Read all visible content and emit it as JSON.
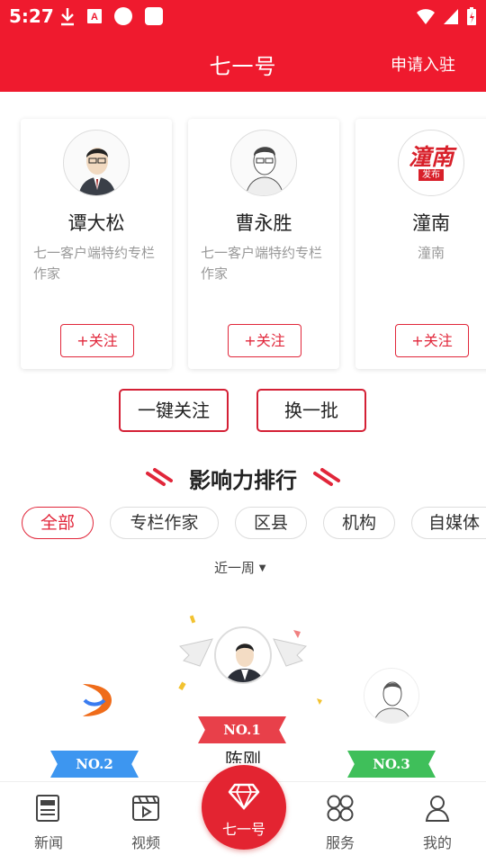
{
  "status": {
    "time": "5:27"
  },
  "header": {
    "title": "七一号",
    "apply": "申请入驻"
  },
  "cards": [
    {
      "name": "谭大松",
      "desc": "七一客户端特约专栏作家",
      "follow": "+关注"
    },
    {
      "name": "曹永胜",
      "desc": "七一客户端特约专栏作家",
      "follow": "+关注"
    },
    {
      "name": "潼南",
      "desc": "潼南",
      "follow": "+关注",
      "logo_text": "潼南",
      "logo_sub": "发布"
    }
  ],
  "actions": {
    "follow_all": "一键关注",
    "refresh": "换一批"
  },
  "ranking": {
    "title": "影响力排行",
    "filters": [
      "全部",
      "专栏作家",
      "区县",
      "机构",
      "自媒体"
    ],
    "active_filter": "全部",
    "period": "近一周",
    "podium": [
      {
        "rank": "NO.1",
        "name": "陈刚"
      },
      {
        "rank": "NO.2",
        "name": ""
      },
      {
        "rank": "NO.3",
        "name": ""
      }
    ]
  },
  "tabbar": {
    "items": [
      {
        "label": "新闻",
        "icon": "news-icon"
      },
      {
        "label": "视频",
        "icon": "video-icon"
      },
      {
        "label": "七一号",
        "icon": "diamond-icon"
      },
      {
        "label": "服务",
        "icon": "service-icon"
      },
      {
        "label": "我的",
        "icon": "profile-icon"
      }
    ]
  },
  "colors": {
    "brand": "#ef1a2e",
    "accent": "#e1263a",
    "muted": "#999999"
  }
}
